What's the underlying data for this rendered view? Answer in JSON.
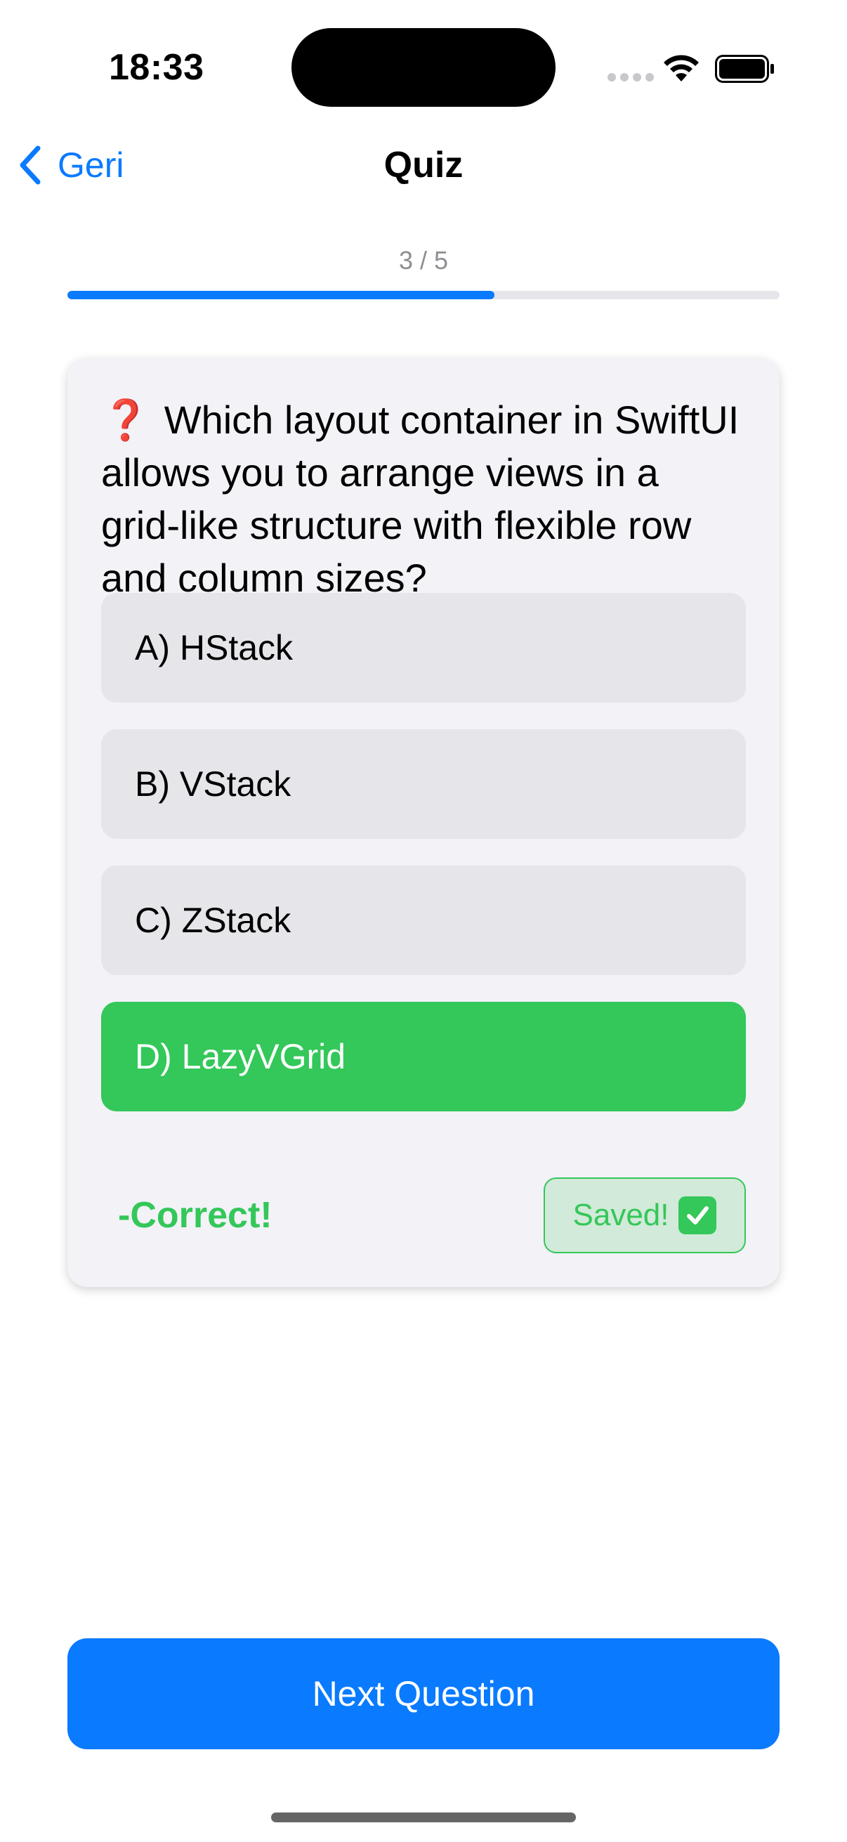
{
  "status_bar": {
    "time": "18:33"
  },
  "nav": {
    "back_label": "Geri",
    "title": "Quiz"
  },
  "progress": {
    "text": "3 / 5",
    "fraction": 0.6
  },
  "question": {
    "icon": "❓",
    "text": "Which layout container in SwiftUI allows you to arrange views in a grid-like structure with flexible row and column sizes?"
  },
  "options": [
    {
      "label": "A) HStack",
      "state": "default"
    },
    {
      "label": "B) VStack",
      "state": "default"
    },
    {
      "label": "C) ZStack",
      "state": "default"
    },
    {
      "label": "D) LazyVGrid",
      "state": "correct"
    }
  ],
  "feedback": {
    "text": "-Correct!"
  },
  "saved_badge": {
    "label": "Saved!",
    "icon": "check-mark-button-icon"
  },
  "footer": {
    "next_label": "Next Question"
  },
  "colors": {
    "accent": "#0a7aff",
    "correct": "#34c759",
    "option_bg": "#e5e5ea",
    "card_bg": "#f2f2f7"
  }
}
